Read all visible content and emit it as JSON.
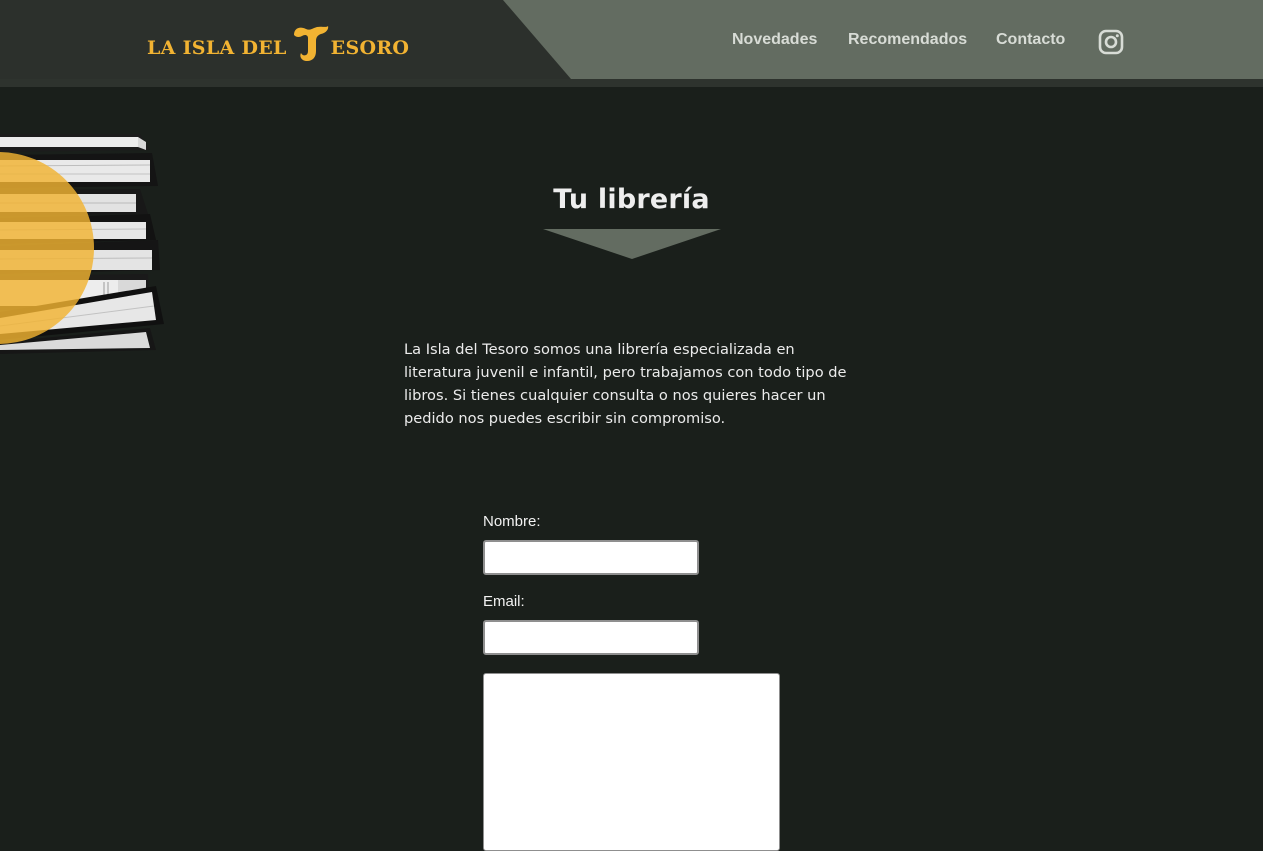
{
  "header": {
    "logo": {
      "lead_text": "LA ISLA DEL",
      "tail_text": "ESORO",
      "colors": {
        "logo": "#f2b332",
        "header_dark": "#2c302c",
        "header_slant": "#636c61"
      }
    },
    "nav": [
      {
        "label": "Novedades"
      },
      {
        "label": "Recomendados"
      },
      {
        "label": "Contacto"
      }
    ],
    "social_icon": "instagram-icon"
  },
  "main": {
    "title": "Tu librería",
    "intro": "La Isla del Tesoro somos una librería especializada en literatura juvenil e infantil, pero trabajamos con todo tipo de libros. Si tienes cualquier consulta o nos quieres hacer un pedido nos puedes escribir sin compromiso.",
    "accent_color": "#636c61",
    "decoration": "book-stack-image"
  },
  "form": {
    "name_label": "Nombre:",
    "name_value": "",
    "email_label": "Email:",
    "email_value": "",
    "message_value": ""
  }
}
